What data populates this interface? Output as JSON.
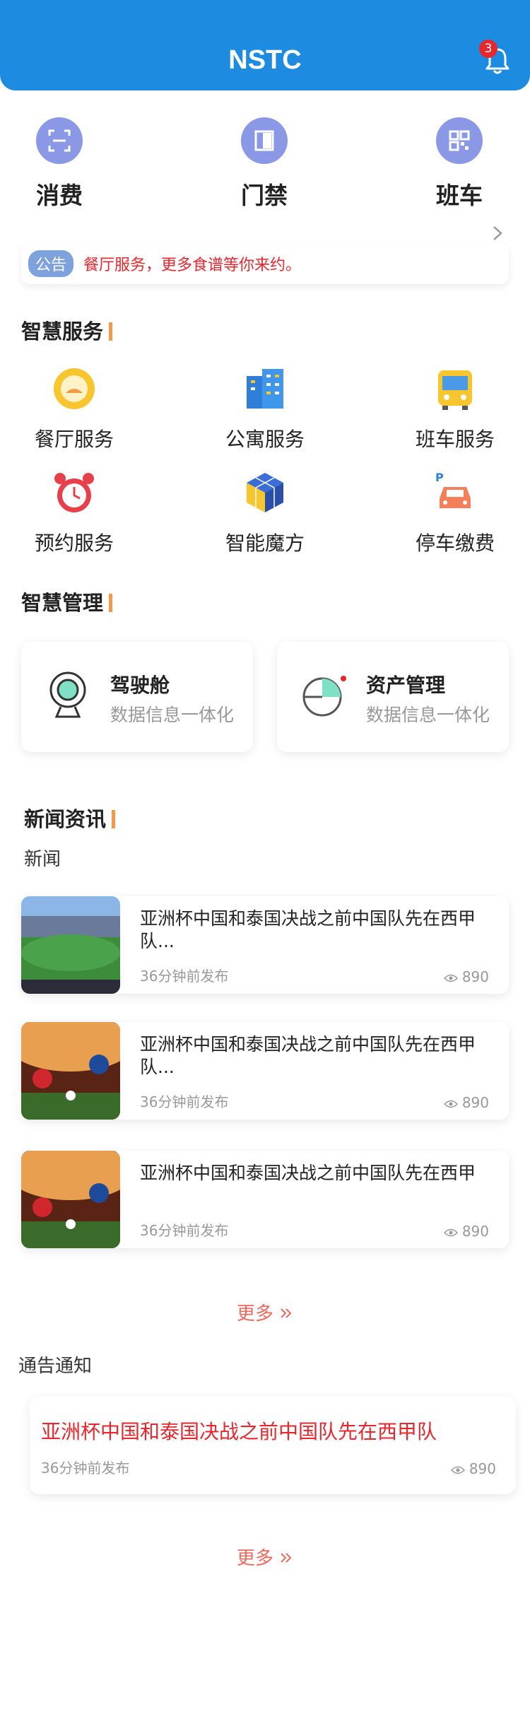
{
  "header": {
    "title": "NSTC",
    "notification_count": "3"
  },
  "quick_actions": [
    {
      "label": "消费",
      "icon": "scan-icon"
    },
    {
      "label": "门禁",
      "icon": "door-icon"
    },
    {
      "label": "班车",
      "icon": "qrcode-icon"
    }
  ],
  "notice": {
    "tag": "公告",
    "text": "餐厅服务，更多食谱等你来约。"
  },
  "smart_services": {
    "title": "智慧服务",
    "items": [
      {
        "label": "餐厅服务",
        "icon": "restaurant-icon"
      },
      {
        "label": "公寓服务",
        "icon": "apartment-icon"
      },
      {
        "label": "班车服务",
        "icon": "bus-icon"
      },
      {
        "label": "预约服务",
        "icon": "alarm-clock-icon"
      },
      {
        "label": "智能魔方",
        "icon": "cube-icon"
      },
      {
        "label": "停车缴费",
        "icon": "parking-car-icon"
      }
    ]
  },
  "smart_management": {
    "title": "智慧管理",
    "cards": [
      {
        "title": "驾驶舱",
        "subtitle": "数据信息一体化",
        "icon": "webcam-icon"
      },
      {
        "title": "资产管理",
        "subtitle": "数据信息一体化",
        "icon": "pie-chart-icon"
      }
    ]
  },
  "news_section": {
    "title": "新闻资讯",
    "subtitle": "新闻",
    "items": [
      {
        "title": "亚洲杯中国和泰国决战之前中国队先在西甲队...",
        "time": "36分钟前发布",
        "views": "890"
      },
      {
        "title": "亚洲杯中国和泰国决战之前中国队先在西甲队...",
        "time": "36分钟前发布",
        "views": "890"
      },
      {
        "title": "亚洲杯中国和泰国决战之前中国队先在西甲",
        "time": "36分钟前发布",
        "views": "890"
      }
    ],
    "more_label": "更多"
  },
  "announcements": {
    "title": "通告通知",
    "item": {
      "title": "亚洲杯中国和泰国决战之前中国队先在西甲队",
      "time": "36分钟前发布",
      "views": "890"
    },
    "more_label": "更多"
  },
  "colors": {
    "primary": "#1d8ce0",
    "accent": "#f39a4a",
    "alert": "#e8262d",
    "more": "#ef6a5e"
  }
}
